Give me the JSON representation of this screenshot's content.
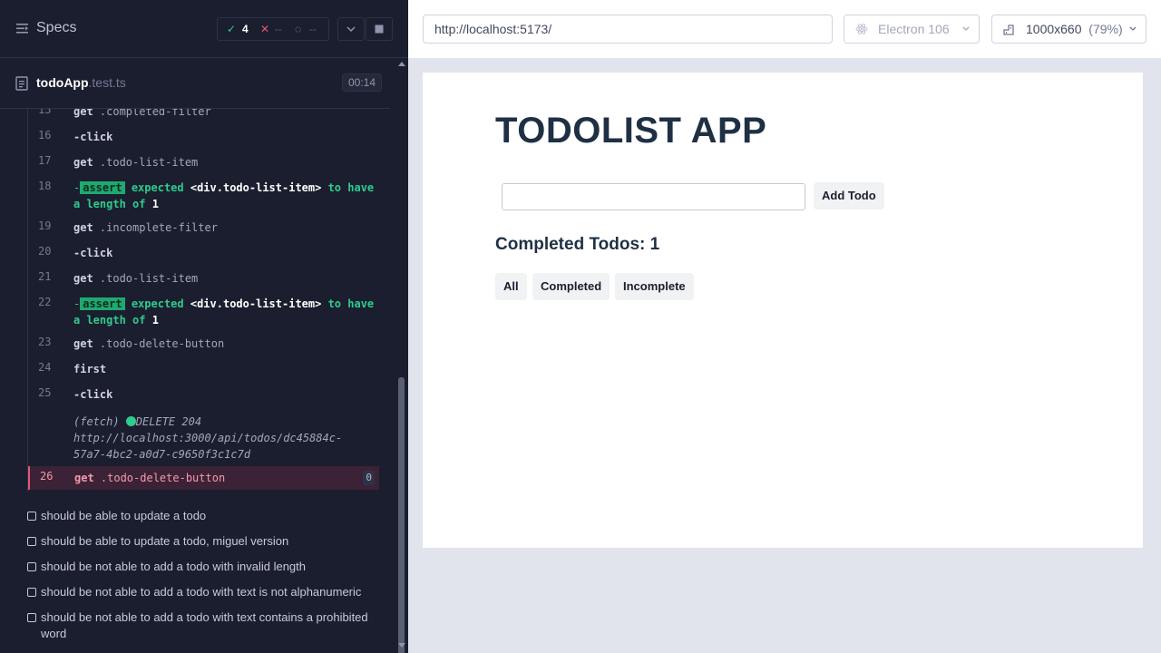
{
  "reporter": {
    "title": "Specs",
    "stats": {
      "passed": "4",
      "failed": "--",
      "pending": "--"
    },
    "spec_file": {
      "name": "todoApp",
      "ext": ".test.ts",
      "duration": "00:14"
    },
    "commands": [
      {
        "num": "15",
        "parts": [
          [
            "kw",
            "get"
          ],
          [
            "sel",
            " .completed-filter"
          ]
        ]
      },
      {
        "num": "16",
        "parts": [
          [
            "kw",
            "-click"
          ]
        ]
      },
      {
        "num": "17",
        "parts": [
          [
            "kw",
            "get"
          ],
          [
            "sel",
            " .todo-list-item"
          ]
        ]
      },
      {
        "num": "18",
        "parts": [
          [
            "ast",
            "-"
          ],
          [
            "astb",
            "assert"
          ],
          [
            "grn",
            " expected "
          ],
          [
            "wht",
            "<div.todo-list-item>"
          ],
          [
            "grn",
            " to have a length of "
          ],
          [
            "wht",
            "1"
          ]
        ]
      },
      {
        "num": "19",
        "parts": [
          [
            "kw",
            "get"
          ],
          [
            "sel",
            " .incomplete-filter"
          ]
        ]
      },
      {
        "num": "20",
        "parts": [
          [
            "kw",
            "-click"
          ]
        ]
      },
      {
        "num": "21",
        "parts": [
          [
            "kw",
            "get"
          ],
          [
            "sel",
            " .todo-list-item"
          ]
        ]
      },
      {
        "num": "22",
        "parts": [
          [
            "ast",
            "-"
          ],
          [
            "astb",
            "assert"
          ],
          [
            "grn",
            " expected "
          ],
          [
            "wht",
            "<div.todo-list-item>"
          ],
          [
            "grn",
            " to have a length of "
          ],
          [
            "wht",
            "1"
          ]
        ]
      },
      {
        "num": "23",
        "parts": [
          [
            "kw",
            "get"
          ],
          [
            "sel",
            " .todo-delete-button"
          ]
        ]
      },
      {
        "num": "24",
        "parts": [
          [
            "kw",
            "first"
          ]
        ]
      },
      {
        "num": "25",
        "parts": [
          [
            "kw",
            "-click"
          ]
        ]
      },
      {
        "num": "",
        "parts": [
          [
            "fetch",
            "(fetch) "
          ],
          [
            "dot",
            ""
          ],
          [
            "fetch",
            "DELETE 204 http://localhost:3000/api/todos/dc45884c-57a7-4bc2-a0d7-c9650f3c1c7d"
          ]
        ]
      }
    ],
    "failed_command": {
      "num": "26",
      "cmd": "get",
      "selector": " .todo-delete-button",
      "count": "0"
    },
    "tests": [
      "should be able to update a todo",
      "should be able to update a todo, miguel version",
      "should be not able to add a todo with invalid length",
      "should be not able to add a todo with text is not alphanumeric",
      "should be not able to add a todo with text contains a prohibited word"
    ]
  },
  "aut": {
    "url": "http://localhost:5173/",
    "browser": "Electron 106",
    "viewport": "1000x660",
    "scale": "(79%)"
  },
  "app": {
    "title": "TODOLIST APP",
    "input_value": "",
    "add_button": "Add Todo",
    "completed_label": "Completed Todos: 1",
    "filters": [
      "All",
      "Completed",
      "Incomplete"
    ]
  },
  "colors": {
    "pass": "#2ecc8e",
    "fail": "#e45770",
    "panel": "#1b1e2e"
  }
}
